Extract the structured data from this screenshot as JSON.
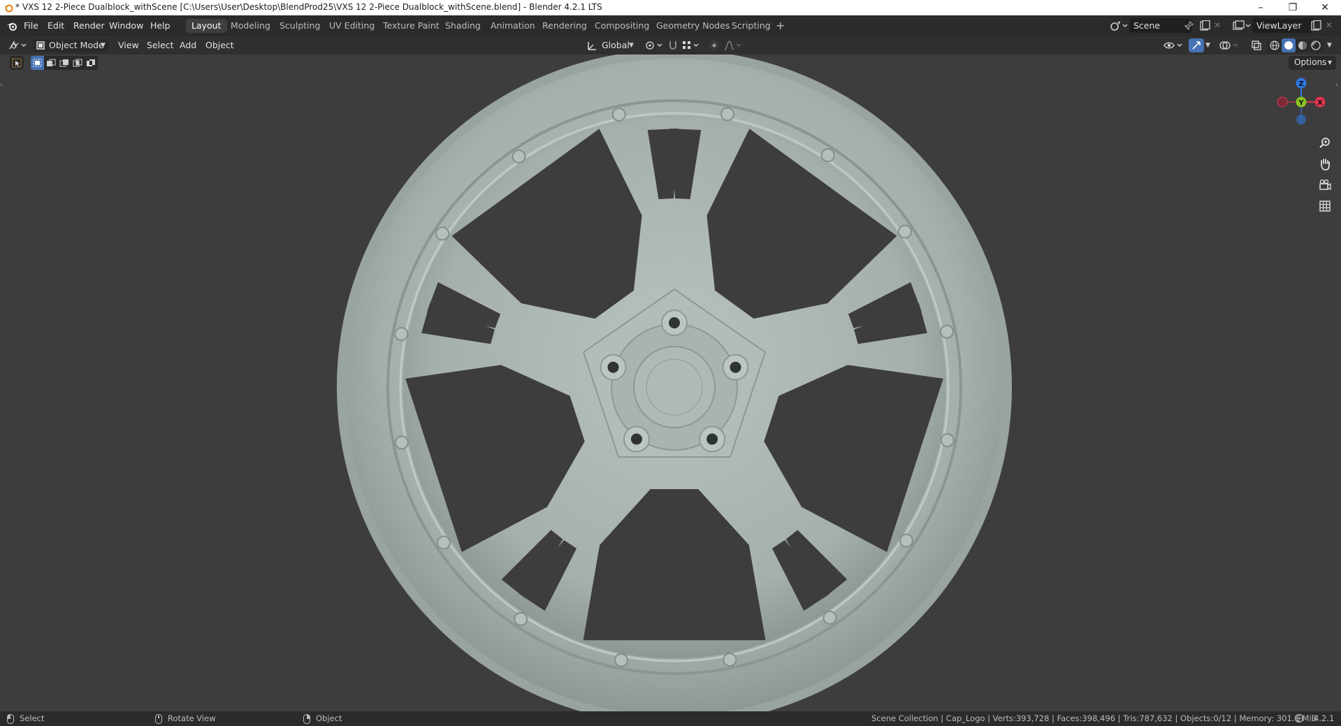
{
  "window": {
    "title": "* VXS 12 2-Piece Dualblock_withScene [C:\\Users\\User\\Desktop\\BlendProd25\\VXS 12 2-Piece Dualblock_withScene.blend] - Blender 4.2.1 LTS",
    "minimize": "–",
    "restore": "❐",
    "close": "✕"
  },
  "menu": {
    "file": "File",
    "edit": "Edit",
    "render": "Render",
    "window": "Window",
    "help": "Help"
  },
  "workspaces": [
    "Layout",
    "Modeling",
    "Sculpting",
    "UV Editing",
    "Texture Paint",
    "Shading",
    "Animation",
    "Rendering",
    "Compositing",
    "Geometry Nodes",
    "Scripting"
  ],
  "workspace_add": "+",
  "scene": {
    "label": "Scene"
  },
  "view_layer": {
    "label": "ViewLayer"
  },
  "viewport_header": {
    "mode": "Object Mode",
    "view": "View",
    "select": "Select",
    "add": "Add",
    "object": "Object",
    "orientation": "Global",
    "options": "Options"
  },
  "gizmo": {
    "z": "Z",
    "y": "Y",
    "x": "X"
  },
  "statusbar": {
    "select": "Select",
    "rotate": "Rotate View",
    "object": "Object",
    "stats": "Scene Collection | Cap_Logo | Verts:393,728 | Faces:398,496 | Tris:787,632 | Objects:0/12 | Memory: 301.1 MiB",
    "version": "4.2.1"
  },
  "colors": {
    "accent": "#4772b3",
    "axis_x": "#e2364f",
    "axis_y": "#8bc41f",
    "axis_z": "#2e77e0",
    "wheel": "#a9b3ad"
  }
}
